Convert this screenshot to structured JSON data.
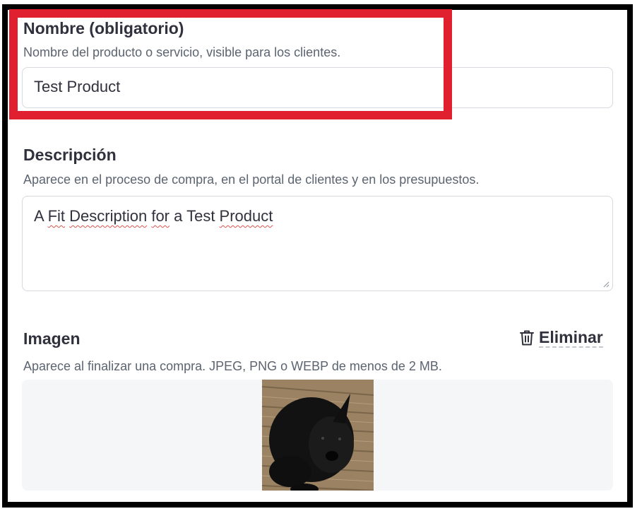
{
  "name_field": {
    "label": "Nombre (obligatorio)",
    "help": "Nombre del producto o servicio, visible para los clientes.",
    "value": "Test Product"
  },
  "description_field": {
    "label": "Descripción",
    "help": "Aparece en el proceso de compra, en el portal de clientes y en los presupuestos.",
    "value_parts": [
      "A ",
      "Fit",
      " ",
      "Description",
      " ",
      "for",
      " a Test ",
      "Product"
    ]
  },
  "image_field": {
    "label": "Imagen",
    "help": "Aparece al finalizar una compra. JPEG, PNG o WEBP de menos de 2 MB.",
    "delete_label": "Eliminar",
    "delete_icon": "trash-icon"
  },
  "colors": {
    "highlight": "#e0202f",
    "frame": "#000000"
  }
}
